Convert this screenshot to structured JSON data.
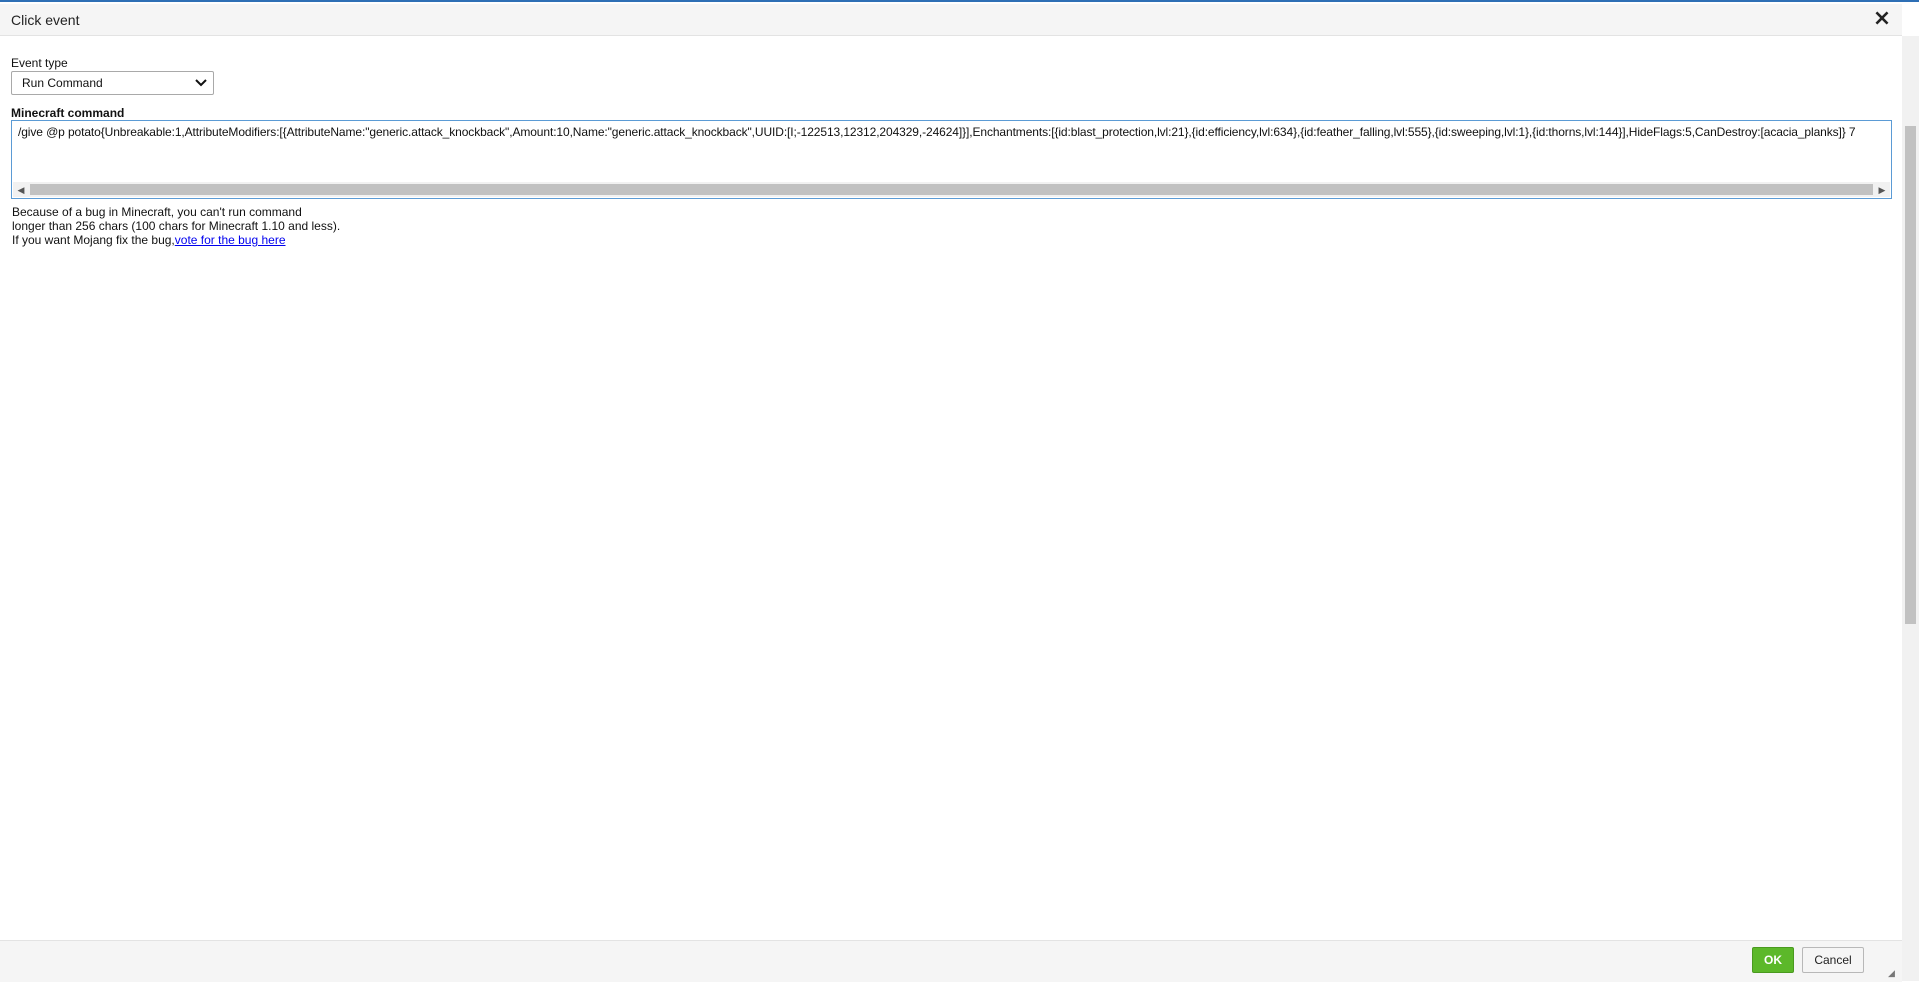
{
  "dialog": {
    "title": "Click event",
    "close_icon": "close-icon"
  },
  "event_type": {
    "label": "Event type",
    "selected": "Run Command"
  },
  "command": {
    "label": "Minecraft command",
    "value": "/give @p potato{Unbreakable:1,AttributeModifiers:[{AttributeName:\"generic.attack_knockback\",Amount:10,Name:\"generic.attack_knockback\",UUID:[I;-122513,12312,204329,-24624]}],Enchantments:[{id:blast_protection,lvl:21},{id:efficiency,lvl:634},{id:feather_falling,lvl:555},{id:sweeping,lvl:1},{id:thorns,lvl:144}],HideFlags:5,CanDestroy:[acacia_planks]} 7"
  },
  "note": {
    "line1": "Because of a bug in Minecraft, you can't run command",
    "line2": "longer than 256 chars (100 chars for Minecraft 1.10 and less).",
    "line3": "If you want Mojang fix the bug,",
    "link": "vote for the bug here"
  },
  "footer": {
    "ok_label": "OK",
    "cancel_label": "Cancel"
  },
  "colors": {
    "ok_button": "#5cb82a",
    "link": "#0000ee",
    "focus_border": "#5b9bd5"
  }
}
